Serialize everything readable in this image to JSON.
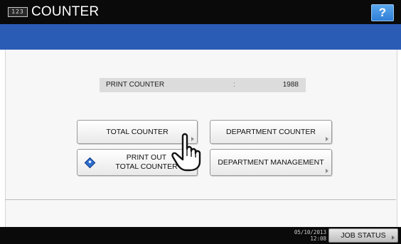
{
  "header": {
    "app_icon_text": "123",
    "title": "COUNTER",
    "help_label": "?"
  },
  "counter": {
    "label": "PRINT COUNTER",
    "separator": ":",
    "value": "1988"
  },
  "buttons": {
    "total_counter": "TOTAL COUNTER",
    "department_counter": "DEPARTMENT COUNTER",
    "print_out_line1": "PRINT OUT",
    "print_out_line2": "TOTAL COUNTER",
    "department_management": "DEPARTMENT MANAGEMENT"
  },
  "status": {
    "date": "05/10/2013",
    "time": "12:08",
    "job_status_label": "JOB STATUS"
  },
  "icons": {
    "app": "counter-app-icon",
    "help": "help-icon",
    "print": "diamond-start-icon",
    "pointer": "hand-pointer-icon"
  },
  "colors": {
    "header_bg": "#0a0a0a",
    "band_blue": "#2a5cb6",
    "help_blue": "#2f7fd6",
    "print_icon_blue": "#2d6fd0"
  }
}
